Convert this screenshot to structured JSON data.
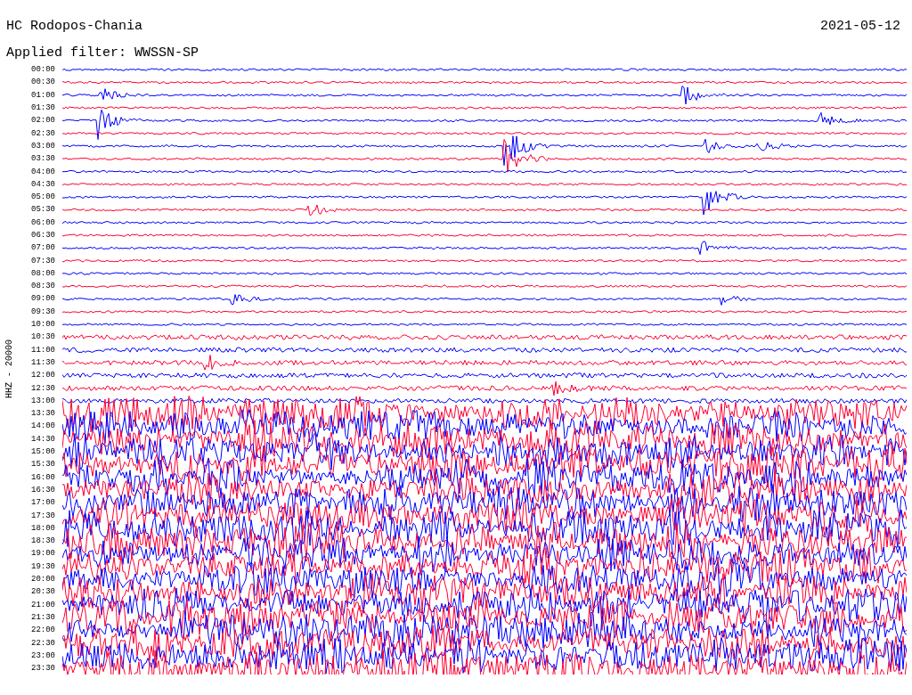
{
  "header": {
    "station": "HC Rodopos-Chania",
    "date": "2021-05-12",
    "filter": "Applied filter: WWSSN-SP"
  },
  "channel_label": "HHZ - 20000",
  "time_labels": [
    "00:00",
    "00:30",
    "01:00",
    "01:30",
    "02:00",
    "02:30",
    "03:00",
    "03:30",
    "04:00",
    "04:30",
    "05:00",
    "05:30",
    "06:00",
    "06:30",
    "07:00",
    "07:30",
    "08:00",
    "08:30",
    "09:00",
    "09:30",
    "10:00",
    "10:30",
    "11:00",
    "11:30",
    "12:00",
    "12:30",
    "13:00",
    "13:30",
    "14:00",
    "14:30",
    "15:00",
    "15:30",
    "16:00",
    "16:30",
    "17:00",
    "17:30",
    "18:00",
    "18:30",
    "19:00",
    "19:30",
    "20:00",
    "20:30",
    "21:00",
    "21:30",
    "22:00",
    "22:30",
    "23:00",
    "23:30"
  ]
}
